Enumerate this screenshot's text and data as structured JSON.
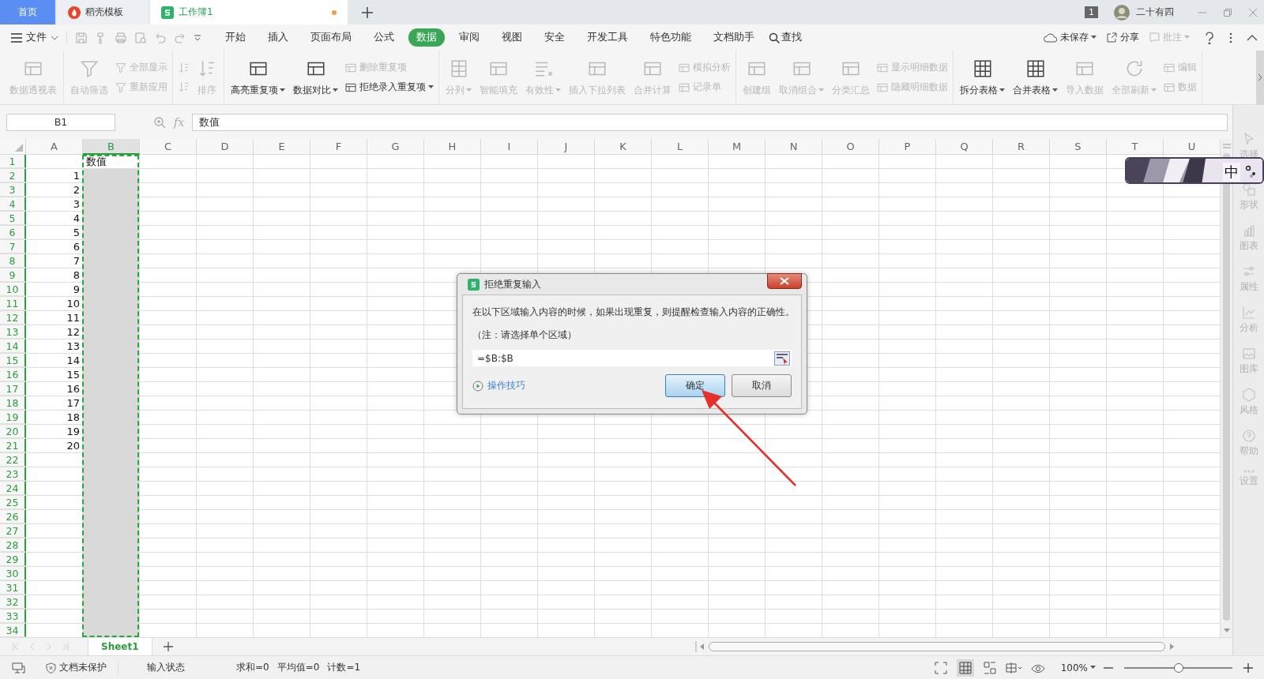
{
  "tabs": [
    {
      "label": "首页",
      "kind": "home",
      "selected": false,
      "unsaved": false
    },
    {
      "label": "稻壳模板",
      "kind": "docer",
      "selected": false,
      "unsaved": false
    },
    {
      "label": "工作簿1",
      "kind": "sheet",
      "selected": true,
      "unsaved": true
    }
  ],
  "account": {
    "badge": "1",
    "user": "二十有四"
  },
  "menu": {
    "file": "文件",
    "search": "查找",
    "tabs": [
      {
        "label": "开始",
        "selected": false
      },
      {
        "label": "插入",
        "selected": false
      },
      {
        "label": "页面布局",
        "selected": false
      },
      {
        "label": "公式",
        "selected": false
      },
      {
        "label": "数据",
        "selected": true
      },
      {
        "label": "审阅",
        "selected": false
      },
      {
        "label": "视图",
        "selected": false
      },
      {
        "label": "安全",
        "selected": false
      },
      {
        "label": "开发工具",
        "selected": false
      },
      {
        "label": "特色功能",
        "selected": false
      },
      {
        "label": "文档助手",
        "selected": false
      }
    ],
    "actions": [
      {
        "label": "未保存",
        "kind": "cloud",
        "disabled": false,
        "dropdown": true
      },
      {
        "label": "分享",
        "kind": "share",
        "disabled": false,
        "dropdown": false
      },
      {
        "label": "批注",
        "kind": "comment",
        "disabled": true,
        "dropdown": true
      }
    ]
  },
  "ribbon": [
    {
      "items": [
        {
          "label": "数据透视表",
          "kind": "large",
          "disabled": true,
          "dropdown": false
        }
      ]
    },
    {
      "items": [
        {
          "label": "自动筛选",
          "kind": "large",
          "disabled": true,
          "dropdown": false
        },
        {
          "label": "全部显示",
          "kind": "small",
          "disabled": true,
          "dropdown": false
        },
        {
          "label": "重新应用",
          "kind": "small",
          "disabled": true,
          "dropdown": false
        }
      ]
    },
    {
      "items": [
        {
          "kind": "icon",
          "disabled": true
        },
        {
          "kind": "icon",
          "disabled": true
        },
        {
          "label": "排序",
          "kind": "large",
          "disabled": true,
          "dropdown": false
        }
      ]
    },
    {
      "items": [
        {
          "label": "高亮重复项",
          "kind": "large",
          "disabled": false,
          "dropdown": true
        },
        {
          "label": "数据对比",
          "kind": "large",
          "disabled": false,
          "dropdown": true
        },
        {
          "label": "删除重复项",
          "kind": "small",
          "disabled": true,
          "dropdown": false
        },
        {
          "label": "拒绝录入重复项",
          "kind": "small",
          "disabled": false,
          "dropdown": true
        }
      ]
    },
    {
      "items": [
        {
          "label": "分列",
          "kind": "large",
          "disabled": true,
          "dropdown": true
        },
        {
          "label": "智能填充",
          "kind": "large",
          "disabled": true,
          "dropdown": false
        },
        {
          "label": "有效性",
          "kind": "large",
          "disabled": true,
          "dropdown": true
        },
        {
          "label": "插入下拉列表",
          "kind": "large",
          "disabled": true,
          "dropdown": false
        },
        {
          "label": "合并计算",
          "kind": "large",
          "disabled": true,
          "dropdown": false
        },
        {
          "label": "模拟分析",
          "kind": "small",
          "disabled": true,
          "dropdown": false
        },
        {
          "label": "记录单",
          "kind": "small",
          "disabled": true,
          "dropdown": false
        }
      ]
    },
    {
      "items": [
        {
          "label": "创建组",
          "kind": "large",
          "disabled": true,
          "dropdown": false
        },
        {
          "label": "取消组合",
          "kind": "large",
          "disabled": true,
          "dropdown": true
        },
        {
          "label": "分类汇总",
          "kind": "large",
          "disabled": true,
          "dropdown": false
        },
        {
          "label": "显示明细数据",
          "kind": "small",
          "disabled": true,
          "dropdown": false
        },
        {
          "label": "隐藏明细数据",
          "kind": "small",
          "disabled": true,
          "dropdown": false
        }
      ]
    },
    {
      "items": [
        {
          "label": "拆分表格",
          "kind": "large",
          "disabled": false,
          "dropdown": true
        },
        {
          "label": "合并表格",
          "kind": "large",
          "disabled": false,
          "dropdown": true
        },
        {
          "label": "导入数据",
          "kind": "large",
          "disabled": true,
          "dropdown": false
        },
        {
          "label": "全部刷新",
          "kind": "large",
          "disabled": true,
          "dropdown": true
        },
        {
          "label": "编辑",
          "kind": "small",
          "disabled": true,
          "dropdown": false
        },
        {
          "label": "数据",
          "kind": "small",
          "disabled": true,
          "dropdown": false
        }
      ]
    }
  ],
  "formula_bar": {
    "name_box": "B1",
    "fx": "fx",
    "value": "数值"
  },
  "sheet": {
    "columns": [
      {
        "label": "A",
        "selected": false
      },
      {
        "label": "B",
        "selected": true
      },
      {
        "label": "C",
        "selected": false
      },
      {
        "label": "D",
        "selected": false
      },
      {
        "label": "E",
        "selected": false
      },
      {
        "label": "F",
        "selected": false
      },
      {
        "label": "G",
        "selected": false
      },
      {
        "label": "H",
        "selected": false
      },
      {
        "label": "I",
        "selected": false
      },
      {
        "label": "J",
        "selected": false
      },
      {
        "label": "K",
        "selected": false
      },
      {
        "label": "L",
        "selected": false
      },
      {
        "label": "M",
        "selected": false
      },
      {
        "label": "N",
        "selected": false
      },
      {
        "label": "O",
        "selected": false
      },
      {
        "label": "P",
        "selected": false
      },
      {
        "label": "Q",
        "selected": false
      },
      {
        "label": "R",
        "selected": false
      },
      {
        "label": "S",
        "selected": false
      },
      {
        "label": "T",
        "selected": false
      },
      {
        "label": "U",
        "selected": false
      }
    ],
    "rows": [
      {
        "label": "1",
        "b": "数值"
      },
      {
        "label": "2",
        "a": "1"
      },
      {
        "label": "3",
        "a": "2"
      },
      {
        "label": "4",
        "a": "3"
      },
      {
        "label": "5",
        "a": "4"
      },
      {
        "label": "6",
        "a": "5"
      },
      {
        "label": "7",
        "a": "6"
      },
      {
        "label": "8",
        "a": "7"
      },
      {
        "label": "9",
        "a": "8"
      },
      {
        "label": "10",
        "a": "9"
      },
      {
        "label": "11",
        "a": "10"
      },
      {
        "label": "12",
        "a": "11"
      },
      {
        "label": "13",
        "a": "12"
      },
      {
        "label": "14",
        "a": "13"
      },
      {
        "label": "15",
        "a": "14"
      },
      {
        "label": "16",
        "a": "15"
      },
      {
        "label": "17",
        "a": "16"
      },
      {
        "label": "18",
        "a": "17"
      },
      {
        "label": "19",
        "a": "18"
      },
      {
        "label": "20",
        "a": "19"
      },
      {
        "label": "21",
        "a": "20"
      },
      {
        "label": "22"
      },
      {
        "label": "23"
      },
      {
        "label": "24"
      },
      {
        "label": "25"
      },
      {
        "label": "26"
      },
      {
        "label": "27"
      },
      {
        "label": "28"
      },
      {
        "label": "29"
      },
      {
        "label": "30"
      },
      {
        "label": "31"
      },
      {
        "label": "32"
      },
      {
        "label": "33"
      },
      {
        "label": "34"
      }
    ]
  },
  "side_panel": [
    {
      "label": "选择"
    },
    {
      "label": "形状"
    },
    {
      "label": "图表"
    },
    {
      "label": "属性"
    },
    {
      "label": "分析"
    },
    {
      "label": "图库"
    },
    {
      "label": "风格"
    },
    {
      "label": "帮助"
    },
    {
      "label": "设置"
    }
  ],
  "ime": {
    "label": "中"
  },
  "sheet_tabs": [
    {
      "label": "Sheet1",
      "selected": true
    }
  ],
  "status_bar": {
    "protection": "文档未保护",
    "mode": "输入状态",
    "stats": [
      "求和=0",
      "平均值=0",
      "计数=1"
    ],
    "zoom": "100%",
    "zoom_slider": {
      "level": 0.5
    }
  },
  "dialog": {
    "title": "拒绝重复输入",
    "message": "在以下区域输入内容的时候，如果出现重复，则提醒检查输入内容的正确性。",
    "note": "（注：请选择单个区域）",
    "range": "=$B:$B",
    "tips_link": "操作技巧",
    "buttons": [
      {
        "label": "确定",
        "default": true
      },
      {
        "label": "取消",
        "default": false
      }
    ]
  }
}
